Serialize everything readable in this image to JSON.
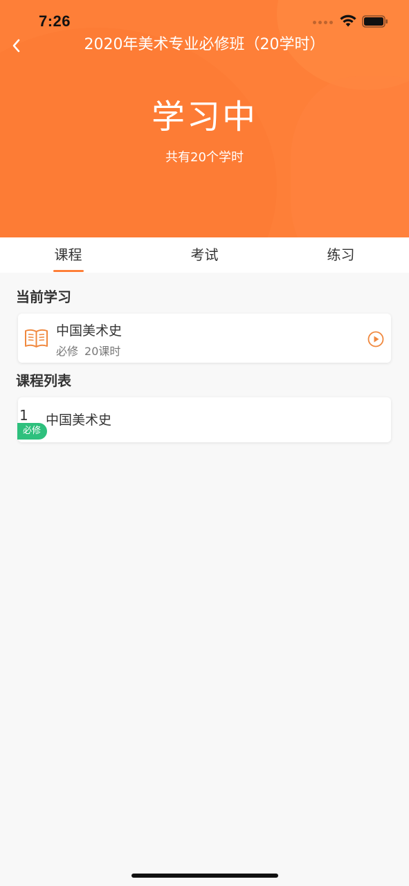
{
  "status_bar": {
    "time": "7:26"
  },
  "nav": {
    "title": "2020年美术专业必修班（20学时）"
  },
  "hero": {
    "status": "学习中",
    "subtitle": "共有20个学时"
  },
  "tabs": [
    {
      "label": "课程",
      "active": true
    },
    {
      "label": "考试",
      "active": false
    },
    {
      "label": "练习",
      "active": false
    }
  ],
  "current": {
    "section_title": "当前学习",
    "course_name": "中国美术史",
    "type": "必修",
    "hours": "20课时"
  },
  "course_list": {
    "section_title": "课程列表",
    "items": [
      {
        "index": "1",
        "name": "中国美术史",
        "badge": "必修"
      }
    ]
  },
  "colors": {
    "accent": "#fe7f38",
    "badge_green": "#2ec07d"
  }
}
